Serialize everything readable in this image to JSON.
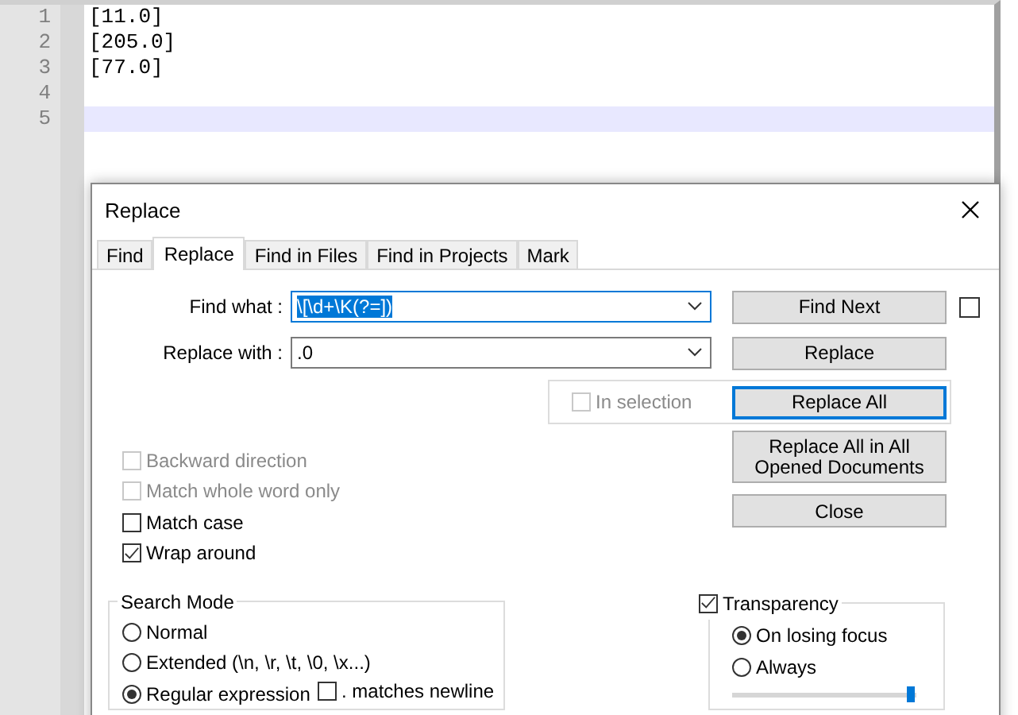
{
  "editor": {
    "lines": [
      {
        "number": "1",
        "text": "[11.0]",
        "current": false
      },
      {
        "number": "2",
        "text": "[205.0]",
        "current": false
      },
      {
        "number": "3",
        "text": "[77.0]",
        "current": false
      },
      {
        "number": "4",
        "current": false
      },
      {
        "number": "5",
        "current": true
      }
    ]
  },
  "dialog": {
    "title": "Replace",
    "tabs": [
      {
        "label": "Find",
        "selected": false
      },
      {
        "label": "Replace",
        "selected": true
      },
      {
        "label": "Find in Files",
        "selected": false
      },
      {
        "label": "Find in Projects",
        "selected": false
      },
      {
        "label": "Mark",
        "selected": false
      }
    ],
    "fields": [
      {
        "label": "Find what :",
        "value": "\\[\\d+\\K(?=])",
        "focused": true,
        "text_selected": true
      },
      {
        "label": "Replace with :",
        "value": ".0",
        "focused": false,
        "text_selected": false
      }
    ],
    "side_checkbox": {
      "checked": false
    },
    "in_selection": {
      "label": "In selection",
      "checked": false,
      "disabled": true
    },
    "buttons": [
      {
        "label": "Find Next",
        "focused": false
      },
      {
        "label": "Replace",
        "focused": false
      },
      {
        "label": "Replace All",
        "focused": true
      },
      {
        "label": "Replace All in All Opened Documents",
        "focused": false
      },
      {
        "label": "Close",
        "focused": false
      }
    ],
    "options": [
      {
        "label": "Backward direction",
        "checked": false,
        "disabled": true
      },
      {
        "label": "Match whole word only",
        "checked": false,
        "disabled": true
      },
      {
        "label": "Match case",
        "checked": false,
        "disabled": false
      },
      {
        "label": "Wrap around",
        "checked": true,
        "disabled": false
      }
    ],
    "search_mode": {
      "title": "Search Mode",
      "options": [
        {
          "label": "Normal",
          "selected": false
        },
        {
          "label": "Extended (\\n, \\r, \\t, \\0, \\x...)",
          "selected": false
        },
        {
          "label": "Regular expression",
          "selected": true
        }
      ],
      "dot_matches_newline": {
        "label": ". matches newline",
        "checked": false
      }
    },
    "transparency": {
      "label": "Transparency",
      "checked": true,
      "options": [
        {
          "label": "On losing focus",
          "selected": true
        },
        {
          "label": "Always",
          "selected": false
        }
      ],
      "level": 1
    }
  }
}
